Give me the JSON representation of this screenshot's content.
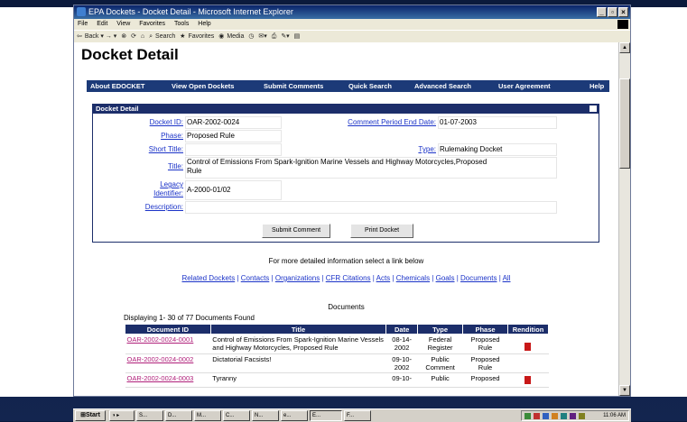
{
  "window": {
    "title": "EPA Dockets - Docket Detail - Microsoft Internet Explorer"
  },
  "menu": [
    "File",
    "Edit",
    "View",
    "Favorites",
    "Tools",
    "Help"
  ],
  "toolbar": {
    "back": "Back",
    "search": "Search",
    "favorites": "Favorites",
    "media": "Media"
  },
  "page": {
    "title": "Docket Detail"
  },
  "nav": [
    "About EDOCKET",
    "View Open Dockets",
    "Submit Comments",
    "Quick Search",
    "Advanced Search",
    "User Agreement",
    "Help"
  ],
  "panel": {
    "header": "Docket Detail",
    "docket_id_label": "Docket ID:",
    "docket_id": "OAR-2002-0024",
    "comment_end_label": "Comment Period End Date:",
    "comment_end": "01-07-2003",
    "phase_label": "Phase:",
    "phase": "Proposed Rule",
    "short_title_label": "Short Title:",
    "type_label": "Type:",
    "type": "Rulemaking Docket",
    "title_label": "Title:",
    "title": "Control of Emissions From Spark-Ignition Marine Vessels and Highway Motorcycles,Proposed Rule",
    "legacy_label_1": "Legacy",
    "legacy_label_2": "Identifier:",
    "legacy": "A-2000-01/02",
    "description_label": "Description:"
  },
  "buttons": {
    "submit_comment": "Submit Comment",
    "print_docket": "Print Docket"
  },
  "info_text": "For more detailed information select a link below",
  "links": [
    "Related Dockets",
    "Contacts",
    "Organizations",
    "CFR Citations",
    "Acts",
    "Chemicals",
    "Goals",
    "Documents",
    "All"
  ],
  "documents": {
    "caption": "Documents",
    "displaying": "Displaying 1- 30 of 77 Documents Found",
    "columns": [
      "Document ID",
      "Title",
      "Date",
      "Type",
      "Phase",
      "Rendition"
    ],
    "rows": [
      {
        "id": "OAR-2002-0024-0001",
        "title": "Control of Emissions From Spark-Ignition Marine Vessels and Highway Motorcycles, Proposed Rule",
        "date": "08-14-2002",
        "type": "Federal Register",
        "phase": "Proposed Rule",
        "rendition": true
      },
      {
        "id": "OAR-2002-0024-0002",
        "title": "Dictatorial Facsists!",
        "date": "09-10-2002",
        "type": "Public Comment",
        "phase": "Proposed Rule",
        "rendition": false
      },
      {
        "id": "OAR-2002-0024-0003",
        "title": "Tyranny",
        "date": "09-10-",
        "type": "Public",
        "phase": "Proposed",
        "rendition": true
      }
    ]
  },
  "taskbar": {
    "start": "Start",
    "clock": "11:06 AM",
    "tasks": [
      "S...",
      "D...",
      "M...",
      "C...",
      "N...",
      "e...",
      "E...",
      "F..."
    ]
  }
}
